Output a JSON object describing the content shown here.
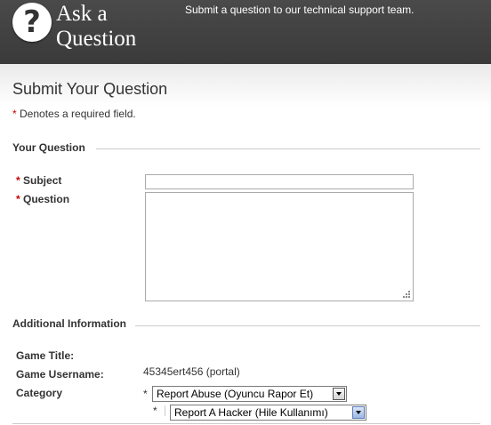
{
  "header": {
    "logo_line1": "Ask a",
    "logo_line2": "Question",
    "tagline": "Submit a question to our technical support team."
  },
  "page": {
    "title": "Submit Your Question",
    "required_marker": "*",
    "required_note": " Denotes a required field."
  },
  "sections": {
    "your_question": "Your Question",
    "additional_info": "Additional Information"
  },
  "fields": {
    "subject_label": "Subject",
    "subject_value": "",
    "question_label": "Question",
    "question_value": "",
    "game_title_label": "Game Title:",
    "game_title_value": "",
    "game_username_label": "Game Username:",
    "game_username_value": "45345ert456 (portal)",
    "category_label": "Category",
    "category_value": "Report Abuse (Oyuncu Rapor Et)",
    "subcategory_value": "Report A Hacker (Hile Kullanımı)"
  },
  "icons": {
    "logo": "question-mark-icon",
    "resize": "resize-grip-icon",
    "dropdown": "chevron-down-icon"
  },
  "colors": {
    "header_bg": "#3f3f3f",
    "required": "#cc0000",
    "dropdown_focus": "#9db7e3"
  }
}
